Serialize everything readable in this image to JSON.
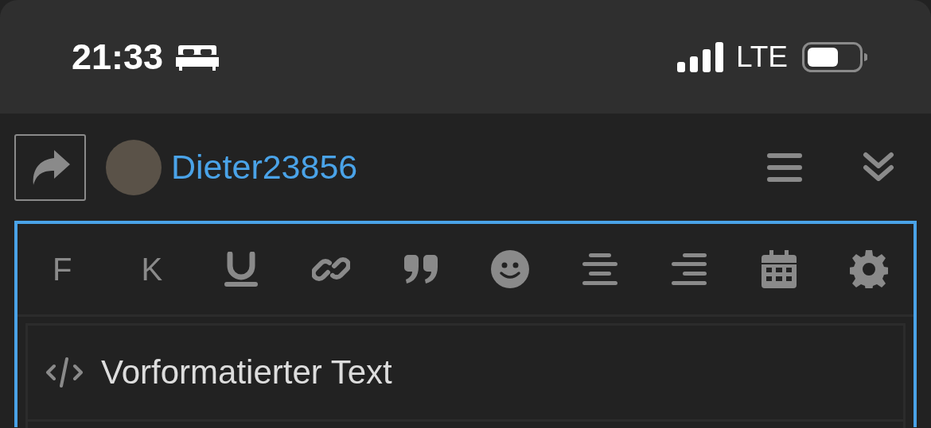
{
  "status_bar": {
    "time": "21:33",
    "network": "LTE"
  },
  "header": {
    "username": "Dieter23856"
  },
  "toolbar": {
    "text_buttons": [
      {
        "label": "F"
      },
      {
        "label": "K"
      }
    ]
  },
  "menu": {
    "items": [
      {
        "label": "Vorformatierter Text"
      }
    ]
  }
}
